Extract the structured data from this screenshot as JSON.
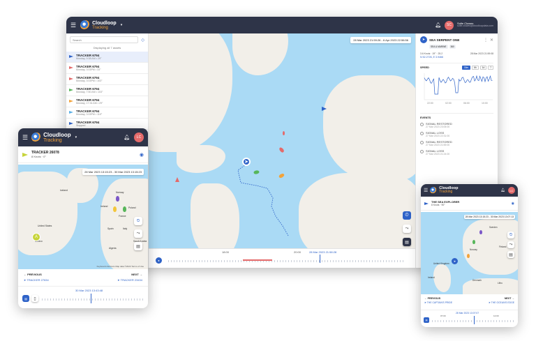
{
  "brand": {
    "name_line1": "Cloudloop",
    "name_line2": "Tracking"
  },
  "desktop": {
    "user_name": "Sofie Clowes",
    "user_email": "sofie.clowes@cloudloopdata.com",
    "avatar_initials": "SC",
    "search_placeholder": "Search",
    "list_caption": "Displaying all 7 assets",
    "trackers": [
      {
        "name": "TRACKER 6794",
        "sub": "Monday, 9:38 AM • 29°",
        "color": "#2f63c8"
      },
      {
        "name": "TRACKER 6794",
        "sub": "Monday, 3:03PM • 33°",
        "color": "#e46a6a"
      },
      {
        "name": "TRACKER 6794",
        "sub": "Monday, 3:03PM • 103°",
        "color": "#e46a6a"
      },
      {
        "name": "TRACKER 6794",
        "sub": "Monday, 7:50 AM • 103°",
        "color": "#57b65a"
      },
      {
        "name": "TRACKER 6794",
        "sub": "Monday, 17:34 AM • 29°",
        "color": "#f3a33a"
      },
      {
        "name": "TRACKER 6794",
        "sub": "Monday, 3:03PM • 110°",
        "color": "#5ab0e6"
      },
      {
        "name": "TRACKER 6794",
        "sub": "Stopped",
        "color": "#2f63c8"
      }
    ],
    "date_range": "28 Mar 2023 21:59:26 - 6 Apr 2023 22:56:56",
    "timeline_current": "28 Mar 2023 21:58:28",
    "timeline_left": "18:00",
    "timeline_mid": "20:00",
    "map_attribution": "Keyboard shortcuts   Map data ©2023 Google, INEGI   Terms of Use",
    "detail": {
      "title": "SEA SERPENT ONE",
      "tag1": "SEA & MARINE",
      "tag2": "360",
      "coords": "3.6 Knots · 19° · 25.2",
      "position": "N 52.2726, E 3.9466",
      "updated": "28 Mar 2023 21:59:08",
      "speed_label": "SPEED",
      "speed_opts": [
        "30m",
        "6h",
        "1d",
        "7"
      ],
      "chart_xticks": [
        "22:00",
        "02:00",
        "06:00",
        "10:00"
      ],
      "events_label": "EVENTS",
      "events": [
        {
          "title": "SIGNAL RESTORED",
          "time": "27 Mar 2023 23:05:00"
        },
        {
          "title": "SIGNAL LOSS",
          "time": "27 Mar 2023 22:31:00"
        },
        {
          "title": "SIGNAL RESTORED",
          "time": "27 Mar 2023 21:59:00"
        },
        {
          "title": "SIGNAL LOSS",
          "time": "27 Mar 2023 21:24:00"
        }
      ]
    }
  },
  "tablet": {
    "avatar_initials": "LC",
    "tracker_title": "TRACKER 26078",
    "tracker_sub": "8 Knots · 0°",
    "date_range": "28 Mar 2023 13:15:23 - 30 Mar 2023 13:15:23",
    "labels": [
      "Iceland",
      "Norway",
      "Ireland",
      "Poland",
      "France",
      "Spain",
      "Italy",
      "Algeria",
      "United States",
      "Mexico",
      "Saudi Arabia"
    ],
    "attribution": "Keyboard shortcuts   Map data ©2023   Terms of Use",
    "prev_label": "PREVIOUS",
    "prev_name": "TRACKER 27634",
    "next_label": "NEXT",
    "next_name": "TRACKER 23434",
    "timeline_current": "30 Mar 2023 13:43:48"
  },
  "phone": {
    "avatar_initials": "LC",
    "tracker_title": "THE SEA EXPLORER",
    "tracker_sub": "8 Knots · 90°",
    "date_range": "28 Mar 2023 13:15:23 - 30 Mar 2023 13:07:13",
    "labels": [
      "Sweden",
      "Norway",
      "Finland",
      "Denmark",
      "United Kingdom",
      "Lithu",
      "Ireland"
    ],
    "prev_label": "PREVIOUS",
    "prev_name": "THE CAPTAIN'S PRIDE",
    "next_label": "NEXT",
    "next_name": "THE OCEAN'S EDGE",
    "timeline_current": "28 Mar 2023 13:07:07",
    "tl_left": "07:00",
    "tl_right": "12:00"
  }
}
